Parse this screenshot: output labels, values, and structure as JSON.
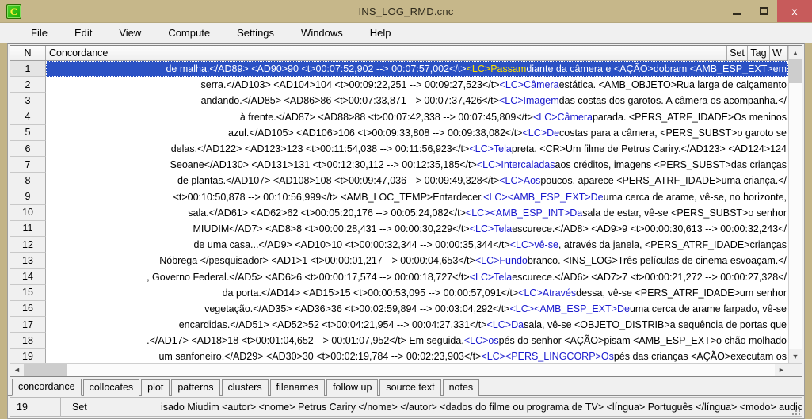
{
  "window": {
    "title": "INS_LOG_RMD.cnc",
    "app_icon": "concordance-app-icon",
    "minimize_label": "Minimize",
    "maximize_label": "Maximize",
    "close_label": "x"
  },
  "menubar": {
    "items": [
      "File",
      "Edit",
      "View",
      "Compute",
      "Settings",
      "Windows",
      "Help"
    ]
  },
  "grid": {
    "headers": {
      "n": "N",
      "concordance": "Concordance",
      "set": "Set",
      "tag": "Tag",
      "w": "W"
    },
    "rows": [
      {
        "n": "1",
        "pre": "de malha.</AD89> <AD90>90 <t>00:07:52,902 --> 00:07:57,002</t> ",
        "kw": "<LC>Passam",
        "post": " diante da câmera e <AÇÃO>dobram <AMB_ESP_EXT>em",
        "selected": true
      },
      {
        "n": "2",
        "pre": "serra.</AD103> <AD104>104 <t>00:09:22,251 --> 00:09:27,523</t> ",
        "kw": "<LC>Câmera",
        "post": " estática. <AMB_OBJETO>Rua larga de calçamento",
        "selected": false
      },
      {
        "n": "3",
        "pre": "andando.</AD85> <AD86>86 <t>00:07:33,871 --> 00:07:37,426</t> ",
        "kw": "<LC>Imagem",
        "post": " das costas dos garotos. A câmera os acompanha.</",
        "selected": false
      },
      {
        "n": "4",
        "pre": "à frente.</AD87> <AD88>88 <t>00:07:42,338 --> 00:07:45,809</t> ",
        "kw": "<LC>Câmera",
        "post": " parada. <PERS_ATRF_IDADE>Os meninos",
        "selected": false
      },
      {
        "n": "5",
        "pre": "azul.</AD105> <AD106>106 <t>00:09:33,808 --> 00:09:38,082</t> ",
        "kw": "<LC>De",
        "post": " costas para a câmera, <PERS_SUBST>o garoto se",
        "selected": false
      },
      {
        "n": "6",
        "pre": "delas.</AD122> <AD123>123 <t>00:11:54,038 --> 00:11:56,923</t> ",
        "kw": "<LC>Tela",
        "post": " preta. <CR>Um filme de Petrus Cariry.</AD123> <AD124>124",
        "selected": false
      },
      {
        "n": "7",
        "pre": "Seoane</AD130> <AD131>131 <t>00:12:30,112 --> 00:12:35,185</t> ",
        "kw": "<LC>Intercaladas",
        "post": " aos créditos, imagens <PERS_SUBST>das crianças",
        "selected": false
      },
      {
        "n": "8",
        "pre": "de plantas.</AD107> <AD108>108 <t>00:09:47,036 --> 00:09:49,328</t> ",
        "kw": "<LC>Aos",
        "post": " poucos, aparece <PERS_ATRF_IDADE>uma criança.</",
        "selected": false
      },
      {
        "n": "9",
        "pre": "<t>00:10:50,878 --> 00:10:56,999</t> <AMB_LOC_TEMP>Entardecer. ",
        "kw": "<LC><AMB_ESP_EXT>De",
        "post": " uma cerca de arame, vê-se, no horizonte,",
        "selected": false
      },
      {
        "n": "10",
        "pre": "sala.</AD61> <AD62>62 <t>00:05:20,176 --> 00:05:24,082</t> ",
        "kw": "<LC><AMB_ESP_INT>Da",
        "post": " sala de estar, vê-se <PERS_SUBST>o senhor",
        "selected": false
      },
      {
        "n": "11",
        "pre": "MIUDIM</AD7> <AD8>8 <t>00:00:28,431 --> 00:00:30,229</t> ",
        "kw": "<LC>Tela",
        "post": " escurece.</AD8> <AD9>9 <t>00:00:30,613 --> 00:00:32,243</",
        "selected": false
      },
      {
        "n": "12",
        "pre": "de uma casa...</AD9> <AD10>10 <t>00:00:32,344 --> 00:00:35,344</t> ",
        "kw": "<LC>vê-se",
        "post": ", através da janela, <PERS_ATRF_IDADE>crianças",
        "selected": false
      },
      {
        "n": "13",
        "pre": "Nóbrega </pesquisador> <AD1>1 <t>00:00:01,217 --> 00:00:04,653</t> ",
        "kw": "<LC>Fundo",
        "post": " branco. <INS_LOG>Três películas de cinema esvoaçam.</",
        "selected": false
      },
      {
        "n": "14",
        "pre": ", Governo Federal.</AD5> <AD6>6 <t>00:00:17,574 --> 00:00:18,727</t> ",
        "kw": "<LC>Tela",
        "post": " escurece.</AD6> <AD7>7 <t>00:00:21,272 --> 00:00:27,328</",
        "selected": false
      },
      {
        "n": "15",
        "pre": "da porta.</AD14> <AD15>15 <t>00:00:53,095 --> 00:00:57,091</t> ",
        "kw": "<LC>Através",
        "post": " dessa, vê-se <PERS_ATRF_IDADE>um senhor",
        "selected": false
      },
      {
        "n": "16",
        "pre": "vegetação.</AD35> <AD36>36 <t>00:02:59,894 --> 00:03:04,292</t> ",
        "kw": "<LC><AMB_ESP_EXT>De",
        "post": " uma cerca de arame farpado, vê-se",
        "selected": false
      },
      {
        "n": "17",
        "pre": "encardidas.</AD51> <AD52>52 <t>00:04:21,954 --> 00:04:27,331</t> ",
        "kw": "<LC>Da",
        "post": " sala, vê-se <OBJETO_DISTRIB>a sequência de portas que",
        "selected": false
      },
      {
        "n": "18",
        "pre": ".</AD17> <AD18>18 <t>00:01:04,652 --> 00:01:07,952</t> Em seguida, ",
        "kw": "<LC>os",
        "post": " pés do senhor <AÇÃO>pisam <AMB_ESP_EXT>o chão molhado",
        "selected": false
      },
      {
        "n": "19",
        "pre": "um sanfoneiro.</AD29> <AD30>30 <t>00:02:19,784 --> 00:02:23,903</t> ",
        "kw": "<LC><PERS_LINGCORP>Os",
        "post": " pés das crianças <AÇÃO>executam os",
        "selected": false
      }
    ]
  },
  "scrollbars": {
    "vertical_up": "▲",
    "vertical_down": "▼",
    "horizontal_left": "◄",
    "horizontal_right": "►"
  },
  "tabs": [
    {
      "label": "concordance",
      "active": true
    },
    {
      "label": "collocates",
      "active": false
    },
    {
      "label": "plot",
      "active": false
    },
    {
      "label": "patterns",
      "active": false
    },
    {
      "label": "clusters",
      "active": false
    },
    {
      "label": "filenames",
      "active": false
    },
    {
      "label": "follow up",
      "active": false
    },
    {
      "label": "source text",
      "active": false
    },
    {
      "label": "notes",
      "active": false
    }
  ],
  "statusbar": {
    "count": "19",
    "set": "Set",
    "message": "isado Miudim <autor> <nome> Petrus Cariry </nome> </autor> <dados do filme ou programa de TV> <língua> Português </língua> <modo> audiovisual </modo> <produtor> Iluminura Filmes"
  },
  "colors": {
    "titlebar": "#c6b78a",
    "close_button": "#c75b5b",
    "selection": "#2b51c4",
    "keyword": "#1a1acd",
    "selected_keyword": "#ffe400",
    "app_icon_green": "#16a800",
    "app_icon_letter": "#ffef3a"
  }
}
